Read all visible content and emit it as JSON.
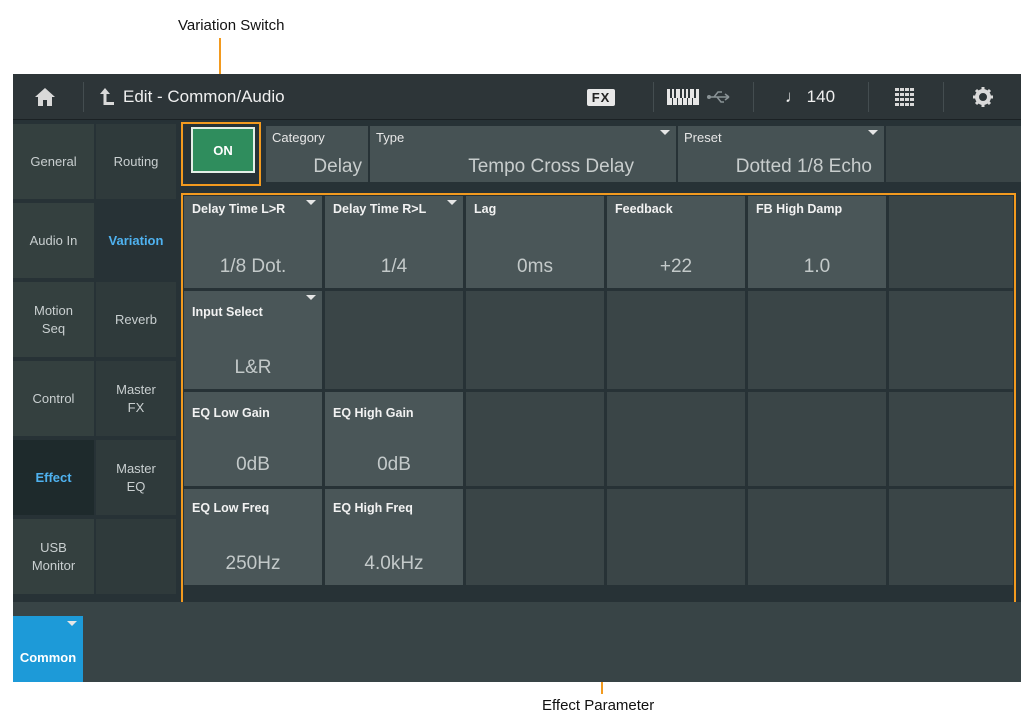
{
  "callouts": {
    "top": "Variation Switch",
    "bottom": "Effect Parameter"
  },
  "topbar": {
    "home_icon": "home-icon",
    "back_icon": "back-arrow-icon",
    "title": "Edit - Common/Audio",
    "fx_badge": "FX",
    "keyboard_icon": "keyboard-icon",
    "usb_icon": "usb-icon",
    "tempo": "♩ 140",
    "grid_icon": "grid-icon",
    "settings_icon": "gear-icon"
  },
  "nav_left": [
    "General",
    "Audio In",
    "Motion\nSeq",
    "Control",
    "Effect",
    "USB\nMonitor"
  ],
  "nav_right": [
    "Routing",
    "Variation",
    "Reverb",
    "Master\nFX",
    "Master\nEQ"
  ],
  "header": {
    "switch_label": "ON",
    "category_label": "Category",
    "category_value": "Delay",
    "type_label": "Type",
    "type_value": "Tempo Cross Delay",
    "preset_label": "Preset",
    "preset_value": "Dotted 1/8 Echo"
  },
  "params": [
    {
      "label": "Delay Time L>R",
      "value": "1/8 Dot."
    },
    {
      "label": "Delay Time R>L",
      "value": "1/4"
    },
    {
      "label": "Lag",
      "value": "0ms"
    },
    {
      "label": "Feedback",
      "value": "+22"
    },
    {
      "label": "FB High Damp",
      "value": "1.0"
    },
    {
      "label": "Input Select",
      "value": "L&R"
    },
    {
      "label": "EQ Low Gain",
      "value": "0dB"
    },
    {
      "label": "EQ High Gain",
      "value": "0dB"
    },
    {
      "label": "EQ Low Freq",
      "value": "250Hz"
    },
    {
      "label": "EQ High Freq",
      "value": "4.0kHz"
    }
  ],
  "bottom": {
    "common_tab": "Common"
  },
  "colors": {
    "accent_blue": "#4fb2f0",
    "on_green": "#2f8d5d",
    "callout_orange": "#f29a1f"
  }
}
